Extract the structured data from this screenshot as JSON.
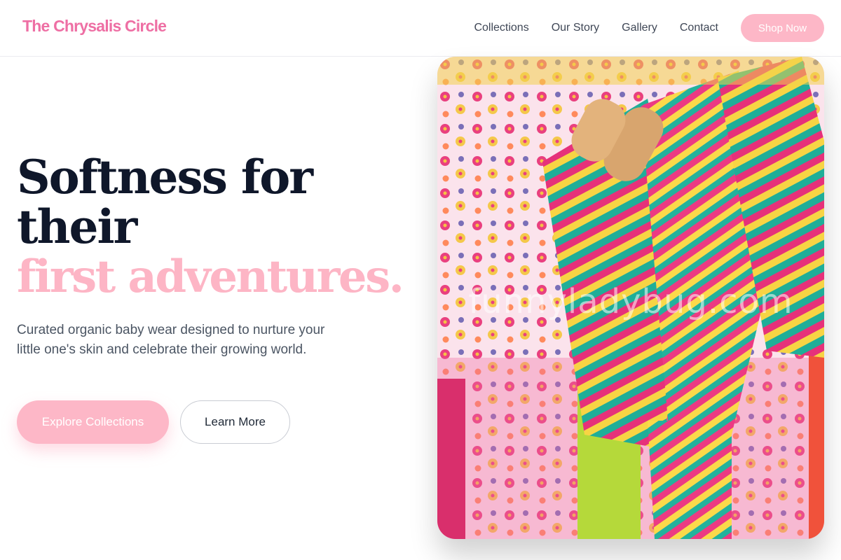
{
  "header": {
    "brand": "The Chrysalis Circle",
    "nav": [
      {
        "label": "Collections"
      },
      {
        "label": "Our Story"
      },
      {
        "label": "Gallery"
      },
      {
        "label": "Contact"
      }
    ],
    "cta_label": "Shop Now"
  },
  "hero": {
    "title_line1": "Softness for",
    "title_line2": "their",
    "title_accent": "first adventures.",
    "description": "Curated organic baby wear designed to nurture your little one's skin and celebrate their growing world.",
    "primary_button": "Explore Collections",
    "secondary_button": "Learn More",
    "image_watermark": "funnyladybug.com"
  },
  "colors": {
    "brand": "#ee6fa4",
    "accent_pink": "#fdb7c7",
    "heading": "#0f172a",
    "body_text": "#4b5563"
  }
}
